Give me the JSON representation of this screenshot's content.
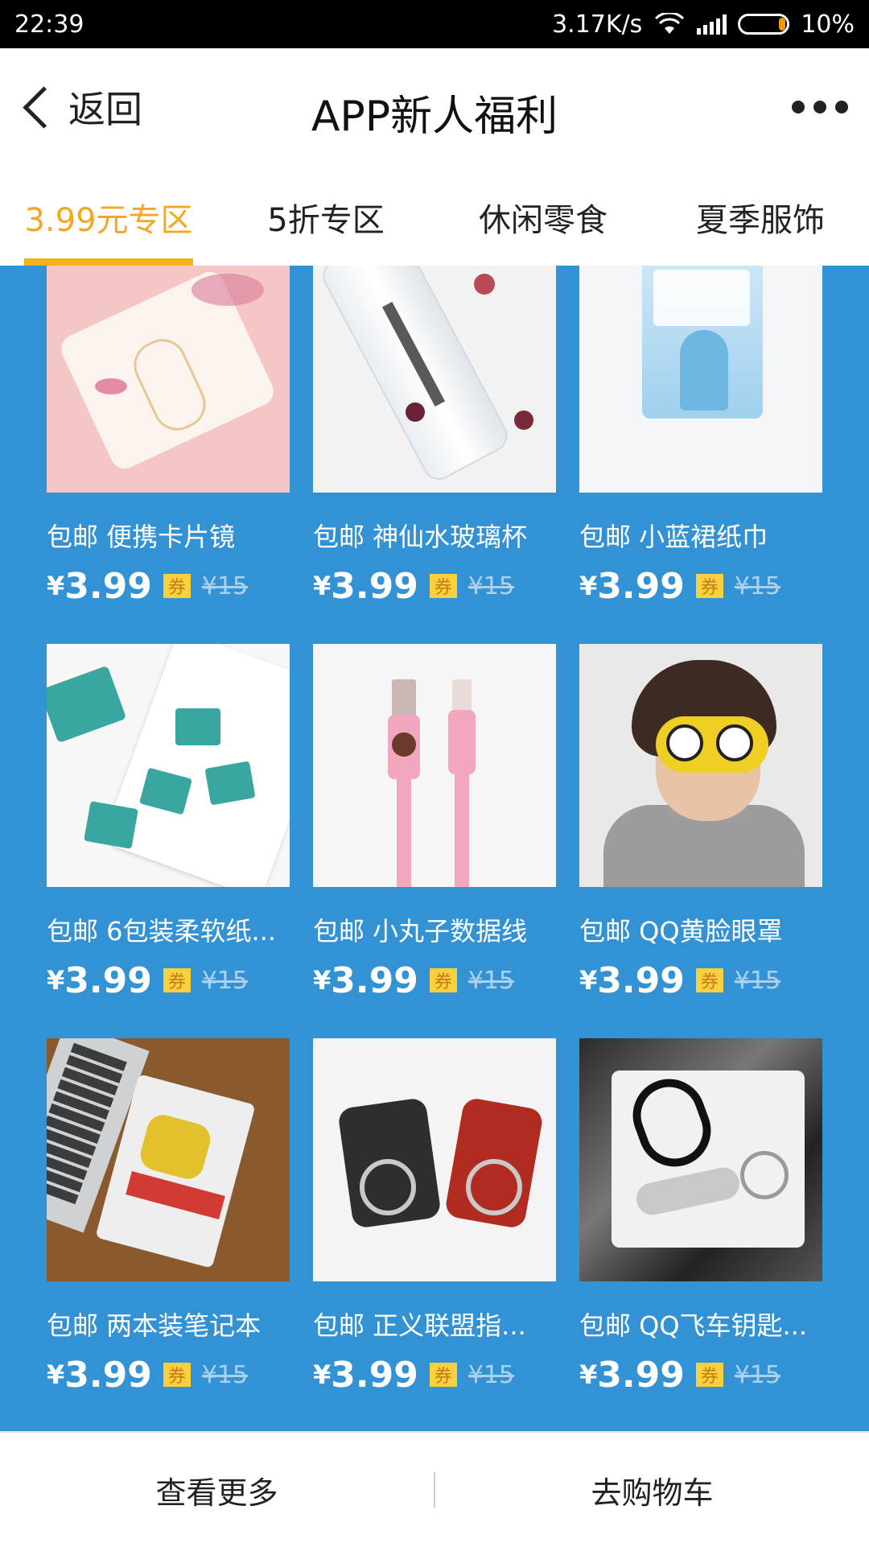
{
  "status": {
    "time": "22:39",
    "speed": "3.17K/s",
    "battery": "10%"
  },
  "header": {
    "back_label": "返回",
    "title": "APP新人福利"
  },
  "tabs": [
    {
      "label": "3.99元专区",
      "active": true
    },
    {
      "label": "5折专区",
      "active": false
    },
    {
      "label": "休闲零食",
      "active": false
    },
    {
      "label": "夏季服饰",
      "active": false
    }
  ],
  "products": [
    {
      "title": "包邮 便携卡片镜",
      "currency": "¥",
      "price": "3.99",
      "coupon": "券",
      "original": "¥15",
      "image": "pink-card-mirror"
    },
    {
      "title": "包邮 神仙水玻璃杯",
      "currency": "¥",
      "price": "3.99",
      "coupon": "券",
      "original": "¥15",
      "image": "glass-bottle"
    },
    {
      "title": "包邮 小蓝裙纸巾",
      "currency": "¥",
      "price": "3.99",
      "coupon": "券",
      "original": "¥15",
      "image": "tissue-pack"
    },
    {
      "title": "包邮 6包装柔软纸...",
      "currency": "¥",
      "price": "3.99",
      "coupon": "券",
      "original": "¥15",
      "image": "mini-tissues"
    },
    {
      "title": "包邮 小丸子数据线",
      "currency": "¥",
      "price": "3.99",
      "coupon": "券",
      "original": "¥15",
      "image": "pink-cable"
    },
    {
      "title": "包邮 QQ黄脸眼罩",
      "currency": "¥",
      "price": "3.99",
      "coupon": "券",
      "original": "¥15",
      "image": "eye-mask"
    },
    {
      "title": "包邮 两本装笔记本",
      "currency": "¥",
      "price": "3.99",
      "coupon": "券",
      "original": "¥15",
      "image": "notebook"
    },
    {
      "title": "包邮 正义联盟指...",
      "currency": "¥",
      "price": "3.99",
      "coupon": "券",
      "original": "¥15",
      "image": "phone-rings"
    },
    {
      "title": "包邮 QQ飞车钥匙...",
      "currency": "¥",
      "price": "3.99",
      "coupon": "券",
      "original": "¥15",
      "image": "keychain"
    }
  ],
  "footer": {
    "more_label": "查看更多",
    "cart_label": "去购物车"
  },
  "colors": {
    "accent": "#f5a623",
    "grid_background": "#3392d3",
    "coupon": "#f8d13c"
  }
}
